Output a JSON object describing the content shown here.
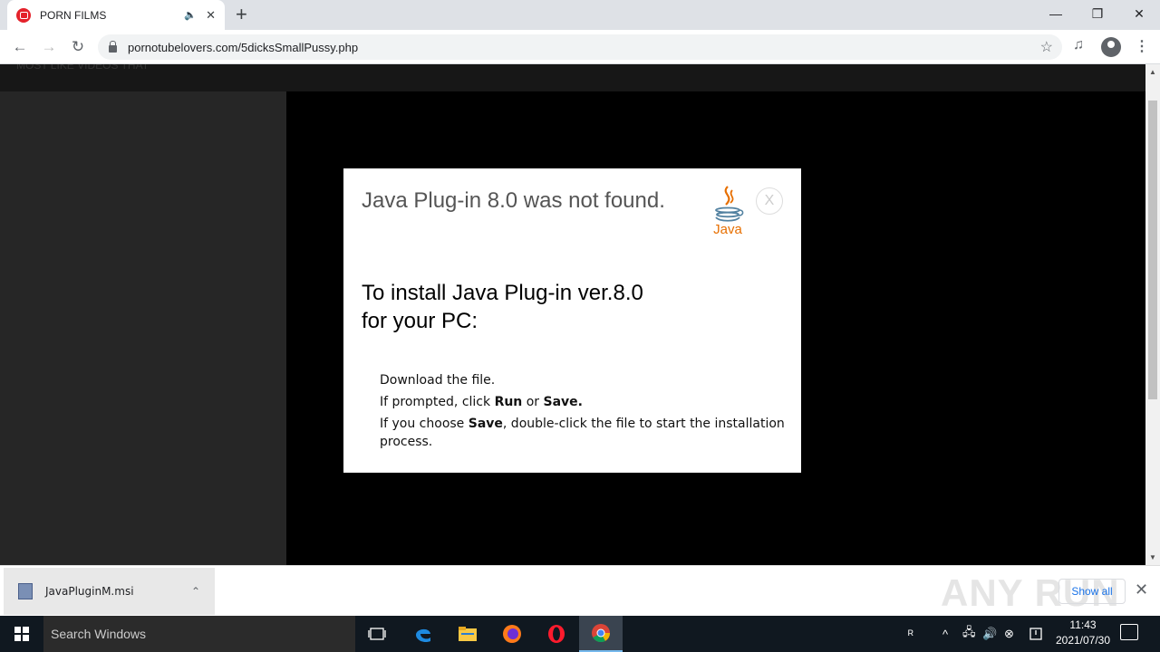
{
  "browser": {
    "tab": {
      "title": "PORN FILMS",
      "mute_icon": "🔈",
      "close": "✕"
    },
    "new_tab": "+",
    "window_controls": [
      "—",
      "❐",
      "✕"
    ],
    "nav": {
      "back": "←",
      "forward": "→",
      "reload": "↻"
    },
    "url": "pornotubelovers.com/5dicksSmallPussy.php",
    "star": "☆",
    "menu": "⋮"
  },
  "page": {
    "ghost_text": "MOST LIKE VIDEOS THAT"
  },
  "modal": {
    "heading": "Java Plug-in 8.0 was not found.",
    "logo_text": "Java",
    "close": "X",
    "subheading": "To install Java Plug-in ver.8.0 for your PC:",
    "step1": "Download the file.",
    "step2_pre": "If prompted, click ",
    "step2_run": "Run",
    "step2_or": " or ",
    "step2_save": "Save",
    "step2_end": ".",
    "step3_pre": "If you choose ",
    "step3_save": "Save",
    "step3_post": ", double-click the file to start the installation process."
  },
  "download_bar": {
    "filename": "JavaPluginM.msi",
    "chevron": "⌃",
    "show_all": "Show all",
    "close": "✕",
    "watermark": "ANY RUN"
  },
  "taskbar": {
    "search_placeholder": "Search Windows",
    "time": "11:43",
    "date": "2021/07/30",
    "tray_items": [
      "ᴿ",
      "^",
      "🖧",
      "🔊",
      "⊗"
    ]
  },
  "colors": {
    "java_red": "#e76f00",
    "java_blue": "#5382a1",
    "link_blue": "#1a73e8",
    "favicon_red": "#e4222b"
  }
}
